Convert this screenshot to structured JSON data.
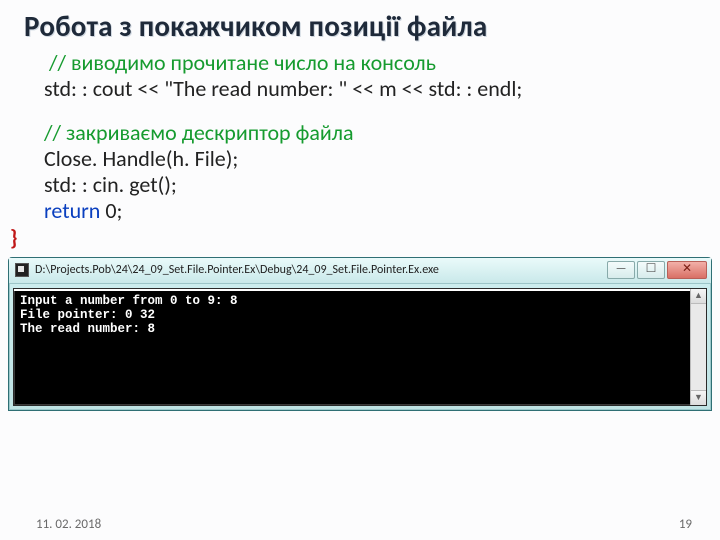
{
  "title": "Робота з покажчиком позиції файла",
  "code": {
    "comment1_prefix": "//",
    "comment1": " виводимо прочитане число на консоль",
    "line2": "std: : cout << \"The read number: \" << m << std: : endl;",
    "comment2": "// закриваємо дескриптор файла",
    "line4_a": "Close. Handle",
    "line4_b": "(h. File);",
    "line5": "std: : cin. get();",
    "line6_a": "return",
    "line6_b": " 0;",
    "brace": "}"
  },
  "window": {
    "title_path": "D:\\Projects.Pob\\24\\24_09_Set.File.Pointer.Ex\\Debug\\24_09_Set.File.Pointer.Ex.exe",
    "buttons": {
      "min": "—",
      "max": "☐",
      "close": "✕"
    }
  },
  "console": {
    "line1": "Input a number from 0 to 9: 8",
    "line2": "File pointer: 0 32",
    "line3": "The read number: 8",
    "scroll_up": "▲",
    "scroll_down": "▼"
  },
  "footer": {
    "date": "11. 02. 2018",
    "page": "19"
  }
}
